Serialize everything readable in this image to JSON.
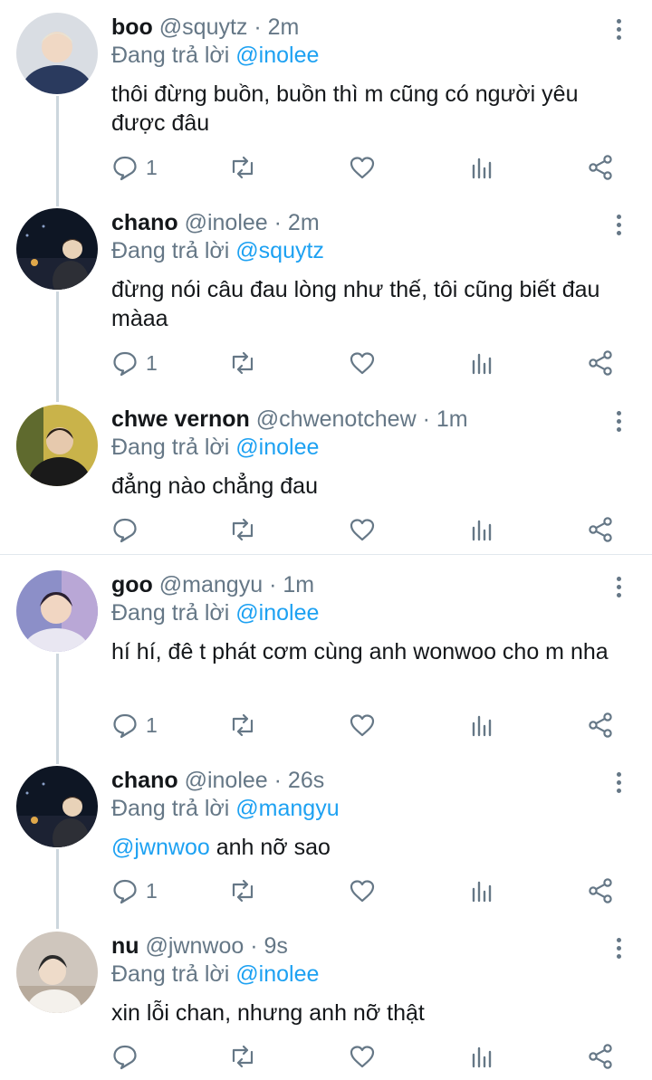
{
  "reply_prefix": "Đang trả lời",
  "tweets": [
    {
      "name": "boo",
      "handle": "@squytz",
      "time": "2m",
      "reply_to": "@inolee",
      "text": "thôi đừng buồn, buồn thì m cũng có người yêu được đâu",
      "reply_count": "1",
      "avatar_colors": [
        "#d9dde3",
        "#2a3a5e",
        "#f0d8c4"
      ]
    },
    {
      "name": "chano",
      "handle": "@inolee",
      "time": "2m",
      "reply_to": "@squytz",
      "text": "đừng nói câu đau lòng như thế, tôi cũng biết đau màaa",
      "reply_count": "1",
      "avatar_colors": [
        "#0e1624",
        "#1c2233",
        "#e8d2b8"
      ]
    },
    {
      "name": "chwe vernon",
      "handle": "@chwenotchew",
      "time": "1m",
      "reply_to": "@inolee",
      "text": "đẳng nào chẳng đau",
      "reply_count": "",
      "avatar_colors": [
        "#c9b34a",
        "#1a1a1a",
        "#e6c9ad"
      ]
    },
    {
      "name": "goo",
      "handle": "@mangyu",
      "time": "1m",
      "reply_to": "@inolee",
      "text": "hí hí, đê t phát cơm cùng anh wonwoo cho m nha",
      "reply_count": "1",
      "avatar_colors": [
        "#8c8fc8",
        "#b9a7d6",
        "#f1d6c2"
      ]
    },
    {
      "name": "chano",
      "handle": "@inolee",
      "time": "26s",
      "reply_to": "@mangyu",
      "text_mention": "@jwnwoo",
      "text": " anh nỡ sao",
      "reply_count": "1",
      "avatar_colors": [
        "#0e1624",
        "#1c2233",
        "#e8d2b8"
      ]
    },
    {
      "name": "nu",
      "handle": "@jwnwoo",
      "time": "9s",
      "reply_to": "@inolee",
      "text": "xin lỗi chan, nhưng anh nỡ thật",
      "reply_count": "",
      "avatar_colors": [
        "#cfc6bd",
        "#2b2b2b",
        "#eedbc9"
      ]
    }
  ],
  "icons": {
    "reply": "comment-bubble-icon",
    "retweet": "retweet-icon",
    "like": "heart-icon",
    "analytics": "bar-chart-icon",
    "share": "share-icon",
    "more": "vertical-dots-icon"
  },
  "colors": {
    "text": "#14171a",
    "secondary": "#657786",
    "mention": "#1da1f2",
    "thread_line": "#ccd6dd"
  }
}
